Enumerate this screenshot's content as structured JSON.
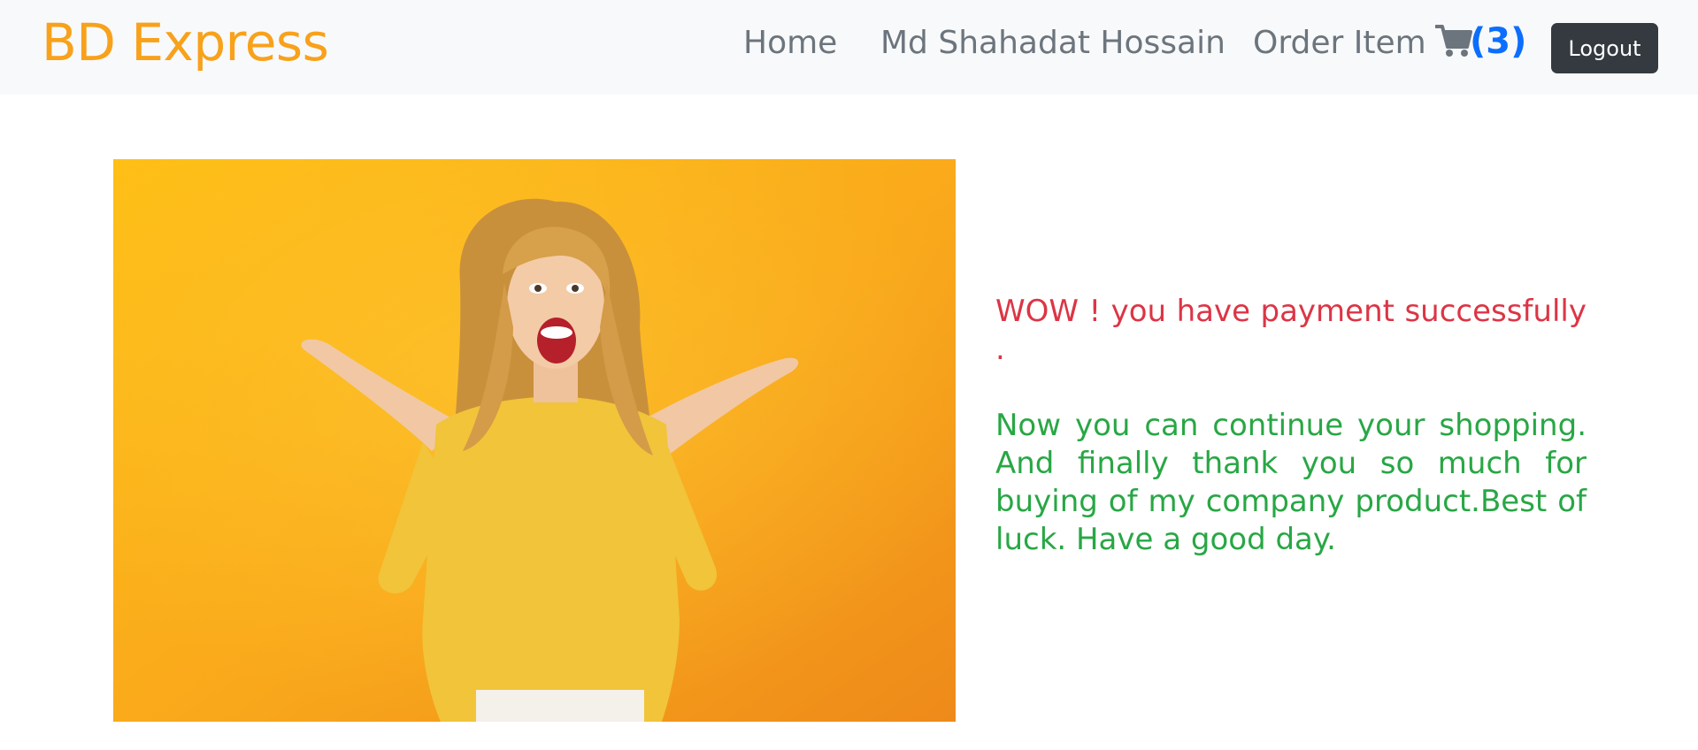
{
  "navbar": {
    "brand": "BD Express",
    "links": [
      "Home",
      "Md Shahadat Hossain",
      "Order Item"
    ],
    "cart_count": "(3)",
    "logout_label": "Logout",
    "brand_color": "#f8a11b",
    "cart_count_color": "#0d6efd"
  },
  "main": {
    "image_icon": "excited-woman-photo",
    "success_message": "WOW ! you have payment successfully .",
    "thank_you_message": "Now you can continue your shopping. And finally thank you so much for buying of my company product.Best of luck. Have a good day.",
    "success_color": "#dc3545",
    "thank_you_color": "#28a745"
  }
}
